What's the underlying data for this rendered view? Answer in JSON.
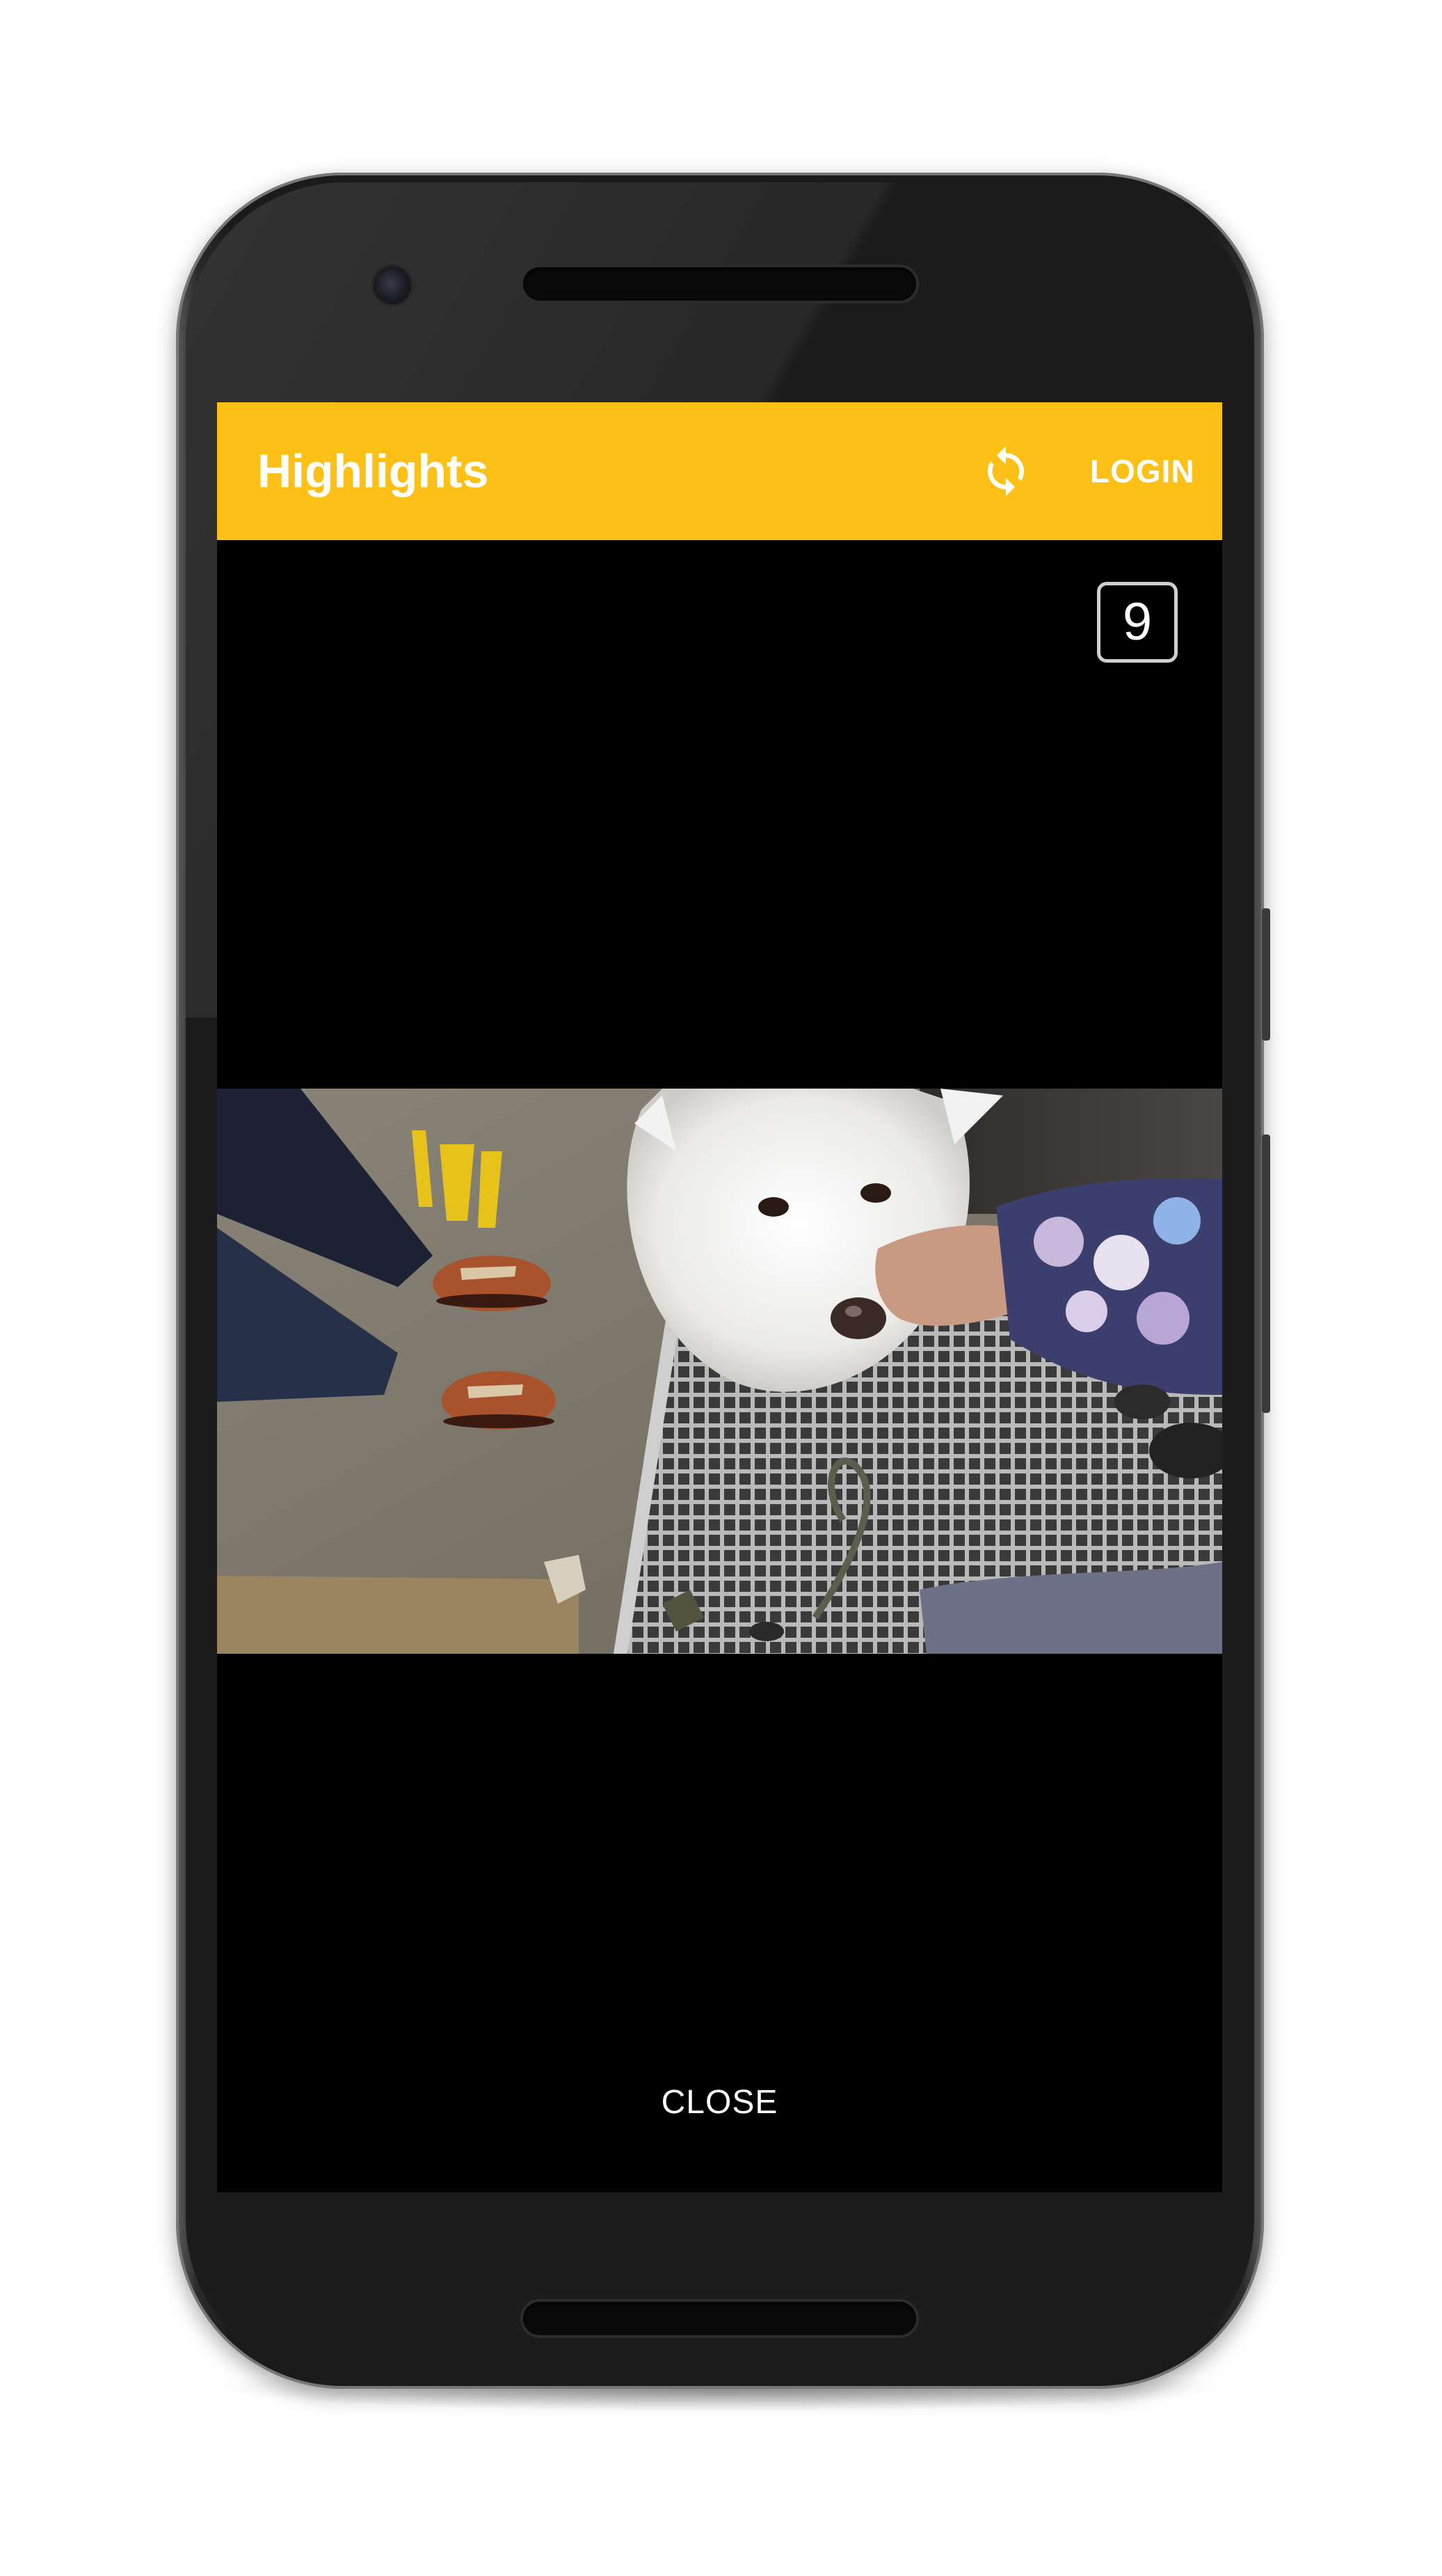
{
  "app_bar": {
    "title": "Highlights",
    "login_label": "LOGIN",
    "refresh_icon": "refresh-icon",
    "background_color": "#fdc017"
  },
  "counter": {
    "value": "9"
  },
  "video": {
    "thumbnail_icon": "video-frame"
  },
  "footer": {
    "close_label": "CLOSE"
  },
  "colors": {
    "screen_background": "#000000",
    "text": "#ffffff"
  }
}
